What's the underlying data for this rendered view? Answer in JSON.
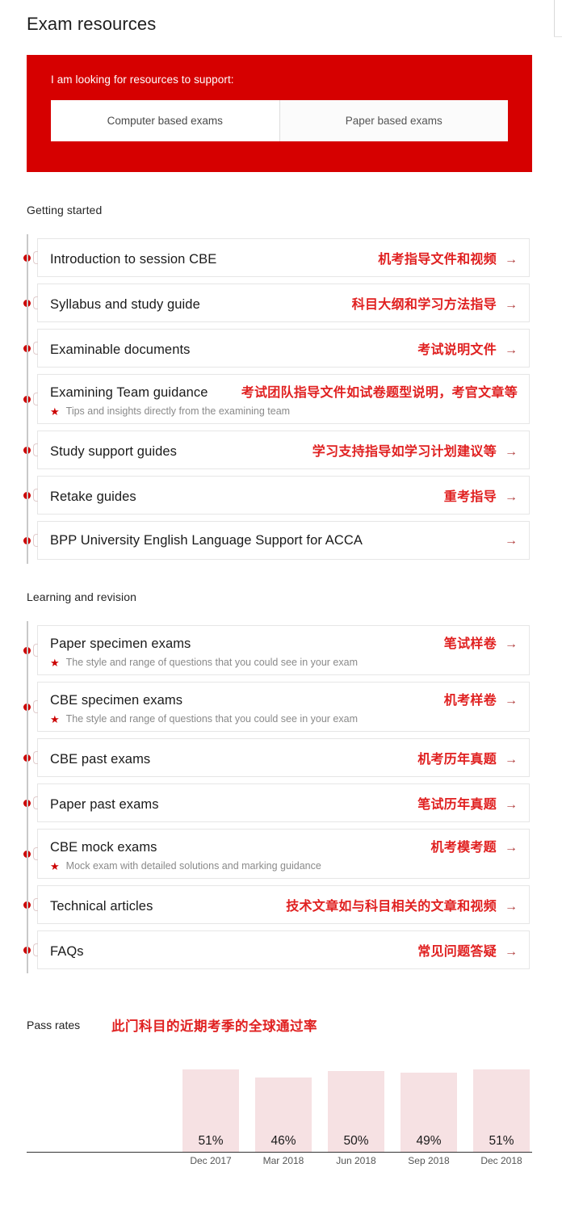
{
  "page": {
    "title": "Exam resources"
  },
  "banner": {
    "label": "I am looking for resources to support:",
    "accent_color": "#d60000",
    "tabs": [
      {
        "label": "Computer based exams",
        "selected": true
      },
      {
        "label": "Paper based exams",
        "selected": false
      }
    ]
  },
  "sections": [
    {
      "heading": "Getting started",
      "items": [
        {
          "title": "Introduction to session CBE",
          "cn": "机考指导文件和视频",
          "sub": "",
          "arrow": "→"
        },
        {
          "title": "Syllabus and study guide",
          "cn": "科目大纲和学习方法指导",
          "sub": "",
          "arrow": "→"
        },
        {
          "title": "Examinable documents",
          "cn": "考试说明文件",
          "sub": "",
          "arrow": "→"
        },
        {
          "title": "Examining Team guidance",
          "cn": "考试团队指导文件如试卷题型说明，考官文章等",
          "sub": "Tips and insights directly from the examining team",
          "arrow": ""
        },
        {
          "title": "Study support guides",
          "cn": "学习支持指导如学习计划建议等",
          "sub": "",
          "arrow": "→"
        },
        {
          "title": "Retake guides",
          "cn": "重考指导",
          "sub": "",
          "arrow": "→"
        },
        {
          "title": "BPP University English Language Support for ACCA",
          "cn": "",
          "sub": "",
          "arrow": "→"
        }
      ]
    },
    {
      "heading": "Learning and revision",
      "items": [
        {
          "title": "Paper specimen exams",
          "cn": "笔试样卷",
          "sub": "The style and range of questions that you could see in your exam",
          "arrow": "→"
        },
        {
          "title": "CBE specimen exams",
          "cn": "机考样卷",
          "sub": "The style and range of questions that you could see in your exam",
          "arrow": "→"
        },
        {
          "title": "CBE past exams",
          "cn": "机考历年真题",
          "sub": "",
          "arrow": "→"
        },
        {
          "title": "Paper past exams",
          "cn": "笔试历年真题",
          "sub": "",
          "arrow": "→"
        },
        {
          "title": "CBE mock exams",
          "cn": "机考模考题",
          "sub": "Mock exam with detailed solutions and marking guidance",
          "arrow": "→"
        },
        {
          "title": "Technical articles",
          "cn": "技术文章如与科目相关的文章和视频",
          "sub": "",
          "arrow": "→"
        },
        {
          "title": "FAQs",
          "cn": "常见问题答疑",
          "sub": "",
          "arrow": "→"
        }
      ]
    }
  ],
  "pass_rates": {
    "label": "Pass rates",
    "cn": "此门科目的近期考季的全球通过率"
  },
  "chart_data": {
    "type": "bar",
    "title": "Pass rates",
    "categories": [
      "Dec 2017",
      "Mar 2018",
      "Jun 2018",
      "Sep 2018",
      "Dec 2018"
    ],
    "values": [
      51,
      46,
      50,
      49,
      51
    ],
    "value_labels": [
      "51%",
      "46%",
      "50%",
      "49%",
      "51%"
    ],
    "xlabel": "",
    "ylabel": "",
    "ylim": [
      0,
      100
    ],
    "unit": "%",
    "bar_color": "#f6e1e3",
    "grid": false,
    "legend": false
  },
  "icons": {
    "star": "★",
    "arrow": "→"
  }
}
